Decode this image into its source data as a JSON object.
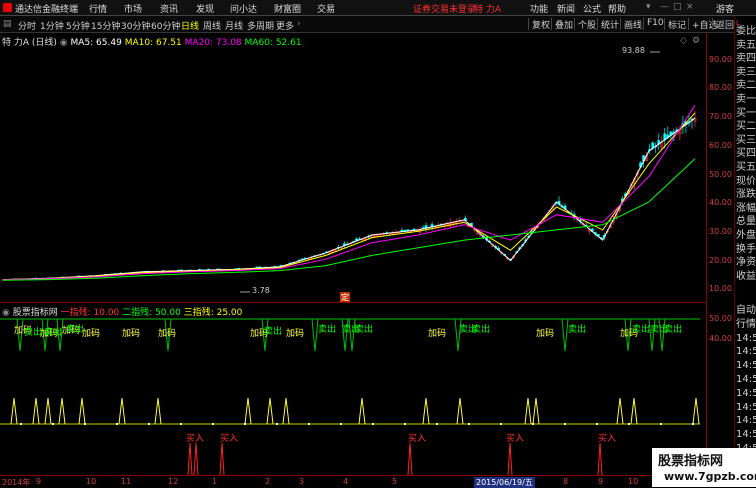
{
  "app": {
    "title": "通达信金融终端"
  },
  "menu": [
    "行情",
    "市场",
    "资讯",
    "发现",
    "问小达",
    "财富圈",
    "交易"
  ],
  "menu_right": {
    "warning": "证券交易未登录",
    "stock": "特 力A",
    "items": [
      "功能",
      "新闻",
      "公式",
      "帮助"
    ],
    "guest": "游客"
  },
  "periods": [
    "分时",
    "1分钟",
    "5分钟",
    "15分钟",
    "30分钟",
    "60分钟",
    "日线",
    "周线",
    "月线",
    "多周期",
    "更多"
  ],
  "periods_selected": "日线",
  "toolbar_right": [
    "复权",
    "叠加",
    "个股",
    "统计",
    "画线",
    "F10",
    "标记",
    "+自选",
    "返回"
  ],
  "main_header": {
    "name": "特 力A (日线)",
    "ma5": "MA5: 65.49",
    "ma10": "MA10: 67.51",
    "ma20": "MA20: 73.08",
    "ma60": "MA60: 52.61"
  },
  "price_axis": [
    "90.00",
    "80.00",
    "70.00",
    "60.00",
    "50.00",
    "40.00",
    "30.00",
    "20.00",
    "10.00"
  ],
  "high_label": "93.88",
  "low_label": "3.78",
  "marker": "定",
  "quote_panel": [
    "委比",
    "卖五",
    "卖四",
    "卖三",
    "卖二",
    "卖一",
    "买一",
    "买二",
    "买三",
    "买四",
    "买五",
    "现价",
    "涨跌",
    "涨幅",
    "总量",
    "外盘",
    "换手",
    "净资",
    "收益"
  ],
  "indicator_header": {
    "name": "股票指标网",
    "l1": "一指残: 10.00",
    "l2": "二指残: 50.00",
    "l3": "三指残: 25.00"
  },
  "indicator_axis": [
    "50.00",
    "40.00"
  ],
  "side_panel": [
    "自动",
    "行情",
    "14:5",
    "14:5",
    "14:5",
    "14:5",
    "14:5",
    "14:5",
    "14:5",
    "14:5",
    "14:5"
  ],
  "signals": {
    "buy": "加码",
    "sell": "卖出",
    "entry": "买入"
  },
  "time_axis": [
    "2014年",
    "9",
    "10",
    "11",
    "12",
    "1",
    "2",
    "3",
    "4",
    "5",
    "2015/06/19/五",
    "8",
    "9",
    "10"
  ],
  "watermark": {
    "line1": "股票指标网",
    "line2": "www.7gpzb.com"
  },
  "colors": {
    "up": "#ff3030",
    "down": "#00ffff",
    "ma5": "#ffffff",
    "ma10": "#ffff00",
    "ma20": "#ff00ff",
    "ma60": "#00ff00"
  },
  "chart_data": {
    "type": "line",
    "x": [
      "2014-08",
      "2014-09",
      "2014-10",
      "2014-11",
      "2014-12",
      "2015-01",
      "2015-02",
      "2015-03",
      "2015-04",
      "2015-05",
      "2015-06",
      "2015-07",
      "2015-08",
      "2015-09",
      "2015-10",
      "2015-11"
    ],
    "series": [
      {
        "name": "MA5",
        "values": [
          4.5,
          5.0,
          6.0,
          7.5,
          8.0,
          8.5,
          9.5,
          15.0,
          22.0,
          24.0,
          28.0,
          12.0,
          35.0,
          20.0,
          55.0,
          68.0
        ]
      },
      {
        "name": "MA10",
        "values": [
          4.5,
          4.9,
          5.8,
          7.2,
          7.8,
          8.3,
          9.2,
          14.0,
          21.0,
          23.5,
          27.0,
          16.0,
          33.0,
          24.0,
          50.0,
          70.0
        ]
      },
      {
        "name": "MA20",
        "values": [
          4.4,
          4.8,
          5.5,
          6.8,
          7.5,
          8.0,
          8.8,
          12.5,
          19.0,
          22.0,
          26.0,
          20.0,
          30.0,
          27.0,
          45.0,
          73.0
        ]
      },
      {
        "name": "MA60",
        "values": [
          4.2,
          4.5,
          5.0,
          6.0,
          6.8,
          7.3,
          8.0,
          10.0,
          14.0,
          17.0,
          20.0,
          22.0,
          24.0,
          26.0,
          35.0,
          52.0
        ]
      }
    ],
    "ylim": [
      0,
      95
    ]
  }
}
